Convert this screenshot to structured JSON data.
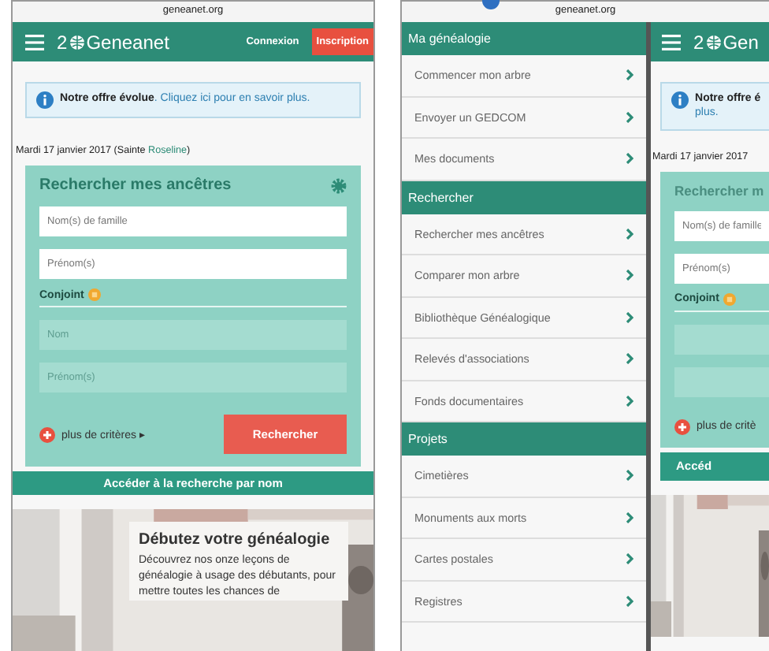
{
  "left": {
    "url": "geneanet.org",
    "header": {
      "logo_number": "2",
      "logo": "Geneanet",
      "login": "Connexion",
      "signup": "Inscription"
    },
    "notice": "**Notre offre évolue**. Cliquez ici pour en savoir plus.",
    "date": {
      "prefix": "Mardi 17 janvier 2017 (Sainte ",
      "saint": "Roseline",
      "suffix": ")"
    },
    "search": {
      "title": "Rechercher mes ancêtres",
      "fields": [
        {
          "placeholder": "Nom(s) de famille",
          "disabled": false
        },
        {
          "placeholder": "Prénom(s)",
          "disabled": false
        }
      ],
      "spouse_label": "Conjoint",
      "spouse_fields": [
        {
          "placeholder": "Nom",
          "disabled": true
        },
        {
          "placeholder": "Prénom(s)",
          "disabled": true
        }
      ],
      "more": "plus de critères",
      "more_caret": "▸",
      "submit": "Rechercher"
    },
    "name_search": "Accéder à la recherche par nom",
    "card": {
      "title": "Débutez votre généalogie",
      "text": "Découvrez nos onze leçons de généalogie à usage des débutants, pour mettre toutes les chances de"
    }
  },
  "right": {
    "url": "geneanet.org",
    "menu": [
      {
        "title": "Ma généalogie",
        "items": [
          {
            "label": "Commencer mon arbre"
          },
          {
            "label": "Envoyer un GEDCOM"
          },
          {
            "label": "Mes documents"
          }
        ]
      },
      {
        "title": "Rechercher",
        "items": [
          {
            "label": "Rechercher mes ancêtres"
          },
          {
            "label": "Comparer mon arbre"
          },
          {
            "label": "Bibliothèque Généalogique"
          },
          {
            "label": "Relevés d'associations"
          },
          {
            "label": "Fonds documentaires"
          }
        ]
      },
      {
        "title": "Projets",
        "items": [
          {
            "label": "Cimetières"
          },
          {
            "label": "Monuments aux morts"
          },
          {
            "label": "Cartes postales"
          },
          {
            "label": "Registres"
          }
        ]
      }
    ],
    "page": {
      "logo_number": "2",
      "logo": "Gen",
      "notice": "**Notre offre é**",
      "notice_more": "plus.",
      "date": "Mardi 17 janvier 2017",
      "search_title": "Rechercher m",
      "fields": [
        {
          "placeholder": "Nom(s) de famille"
        },
        {
          "placeholder": "Prénom(s)"
        }
      ],
      "spouse_label": "Conjoint",
      "more": "plus de critè",
      "name_search": "Accéd"
    }
  }
}
